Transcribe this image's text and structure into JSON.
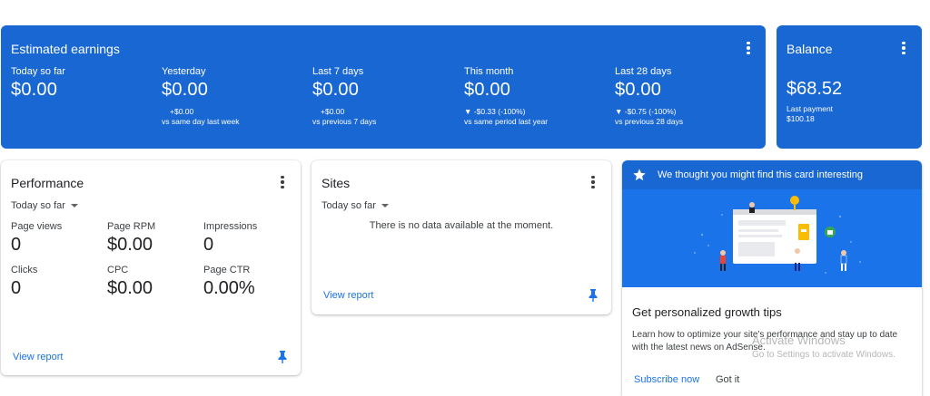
{
  "earnings": {
    "title": "Estimated earnings",
    "metrics": [
      {
        "label": "Today so far",
        "value": "$0.00",
        "change": "",
        "compare": ""
      },
      {
        "label": "Yesterday",
        "value": "$0.00",
        "change": "+$0.00",
        "compare": "vs same day last week"
      },
      {
        "label": "Last 7 days",
        "value": "$0.00",
        "change": "+$0.00",
        "compare": "vs previous 7 days"
      },
      {
        "label": "This month",
        "value": "$0.00",
        "change": "▼ -$0.33 (-100%)",
        "compare": "vs same period last year"
      },
      {
        "label": "Last 28 days",
        "value": "$0.00",
        "change": "▼ -$0.75 (-100%)",
        "compare": "vs previous 28 days"
      }
    ]
  },
  "balance": {
    "title": "Balance",
    "value": "$68.52",
    "last_payment_label": "Last payment",
    "last_payment_value": "$100.18"
  },
  "performance": {
    "title": "Performance",
    "range": "Today so far",
    "metrics": [
      {
        "label": "Page views",
        "value": "0"
      },
      {
        "label": "Page RPM",
        "value": "$0.00"
      },
      {
        "label": "Impressions",
        "value": "0"
      },
      {
        "label": "Clicks",
        "value": "0"
      },
      {
        "label": "CPC",
        "value": "$0.00"
      },
      {
        "label": "Page CTR",
        "value": "0.00%"
      }
    ],
    "link": "View report"
  },
  "sites": {
    "title": "Sites",
    "range": "Today so far",
    "empty": "There is no data available at the moment.",
    "link": "View report"
  },
  "tips": {
    "banner": "We thought you might find this card interesting",
    "title": "Get personalized growth tips",
    "body": "Learn how to optimize your site's performance and stay up to date with the latest news on AdSense.",
    "subscribe": "Subscribe now",
    "dismiss": "Got it"
  },
  "watermark": {
    "line1": "Activate Windows",
    "line2": "Go to Settings to activate Windows."
  },
  "colors": {
    "brand_blue": "#1967d2",
    "link_blue": "#1a73e8"
  }
}
